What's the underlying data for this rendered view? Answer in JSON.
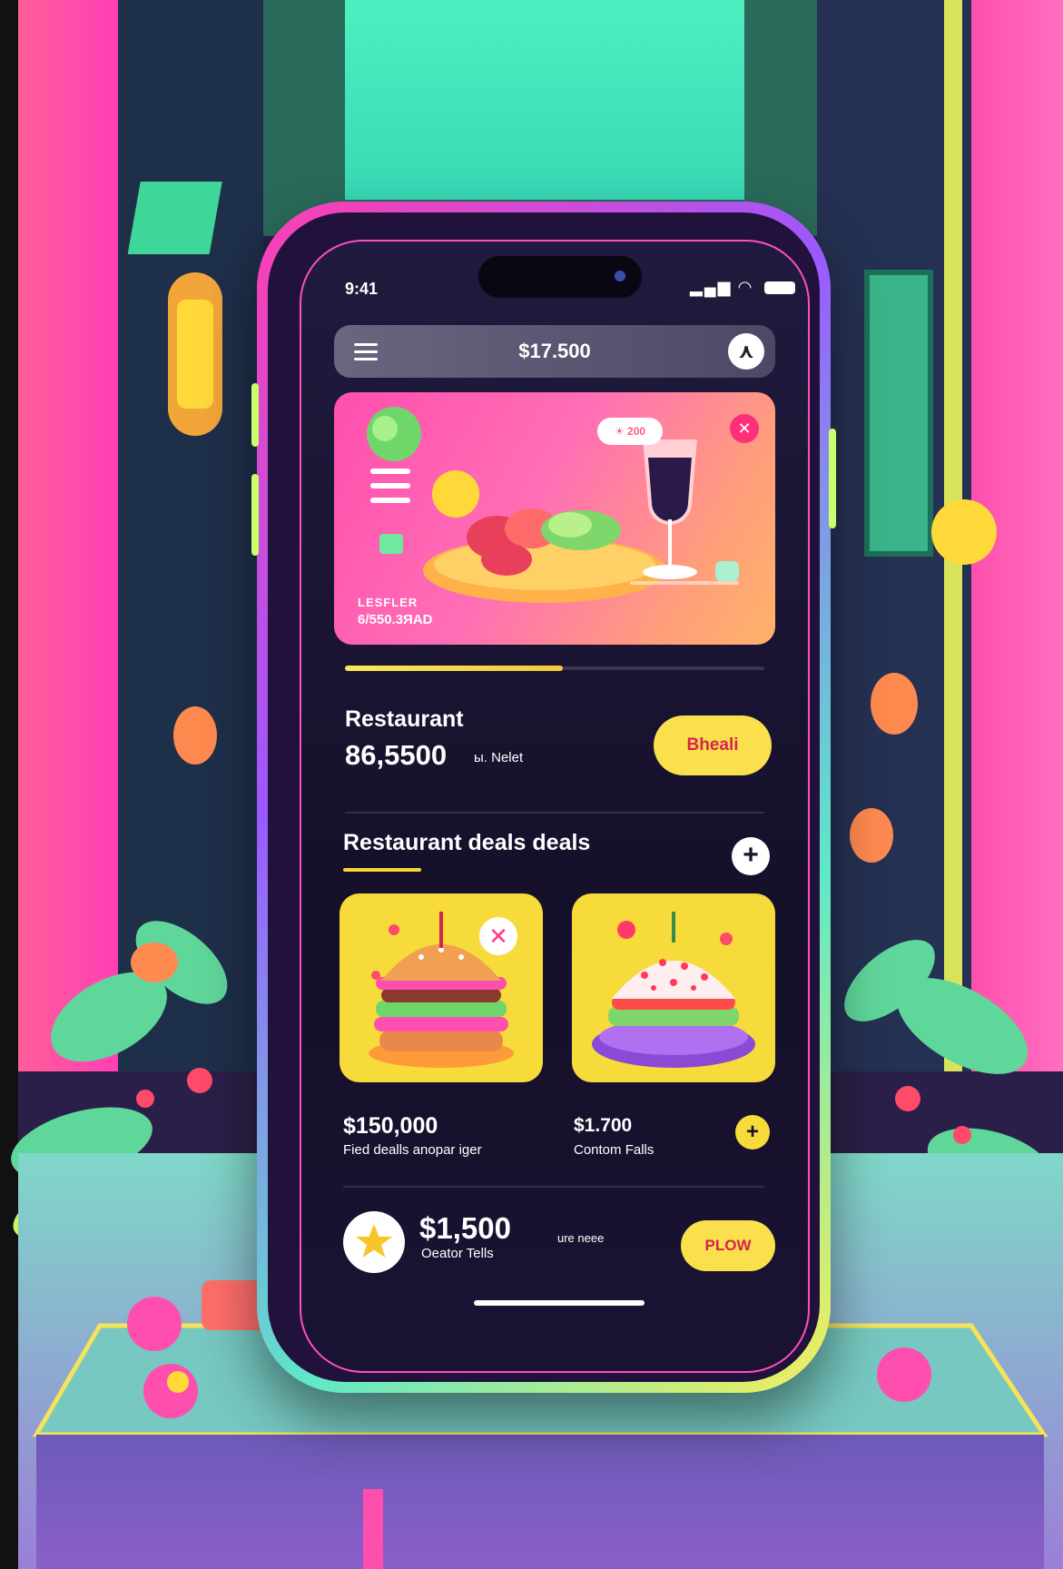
{
  "status_bar": {
    "time": "9:41",
    "signal": "▂▄▆"
  },
  "top_bar": {
    "balance": "$17.500"
  },
  "hero": {
    "badge": "☀ 200",
    "label": "LESFLER",
    "amount": "6/550.3ЯAD",
    "progress_fraction": 0.52
  },
  "restaurant": {
    "title": "Restaurant",
    "amount": "86,5500",
    "unit": "ы. Nelet",
    "button": "Bheali"
  },
  "deals": {
    "title": "Restaurant deals deals",
    "items": [
      {
        "price": "$150,000",
        "desc": "Fied dealls anopar iger"
      },
      {
        "price": "$1.700",
        "desc": "Contom Falls"
      }
    ]
  },
  "bottom_deal": {
    "price": "$1,500",
    "desc": "Oeator Tells",
    "unit": "ure neee",
    "button": "PLOW"
  },
  "colors": {
    "accent_yellow": "#f9e04c",
    "accent_pink": "#ff3fb0",
    "accent_red": "#d6234f",
    "screen_bg": "#151029"
  }
}
